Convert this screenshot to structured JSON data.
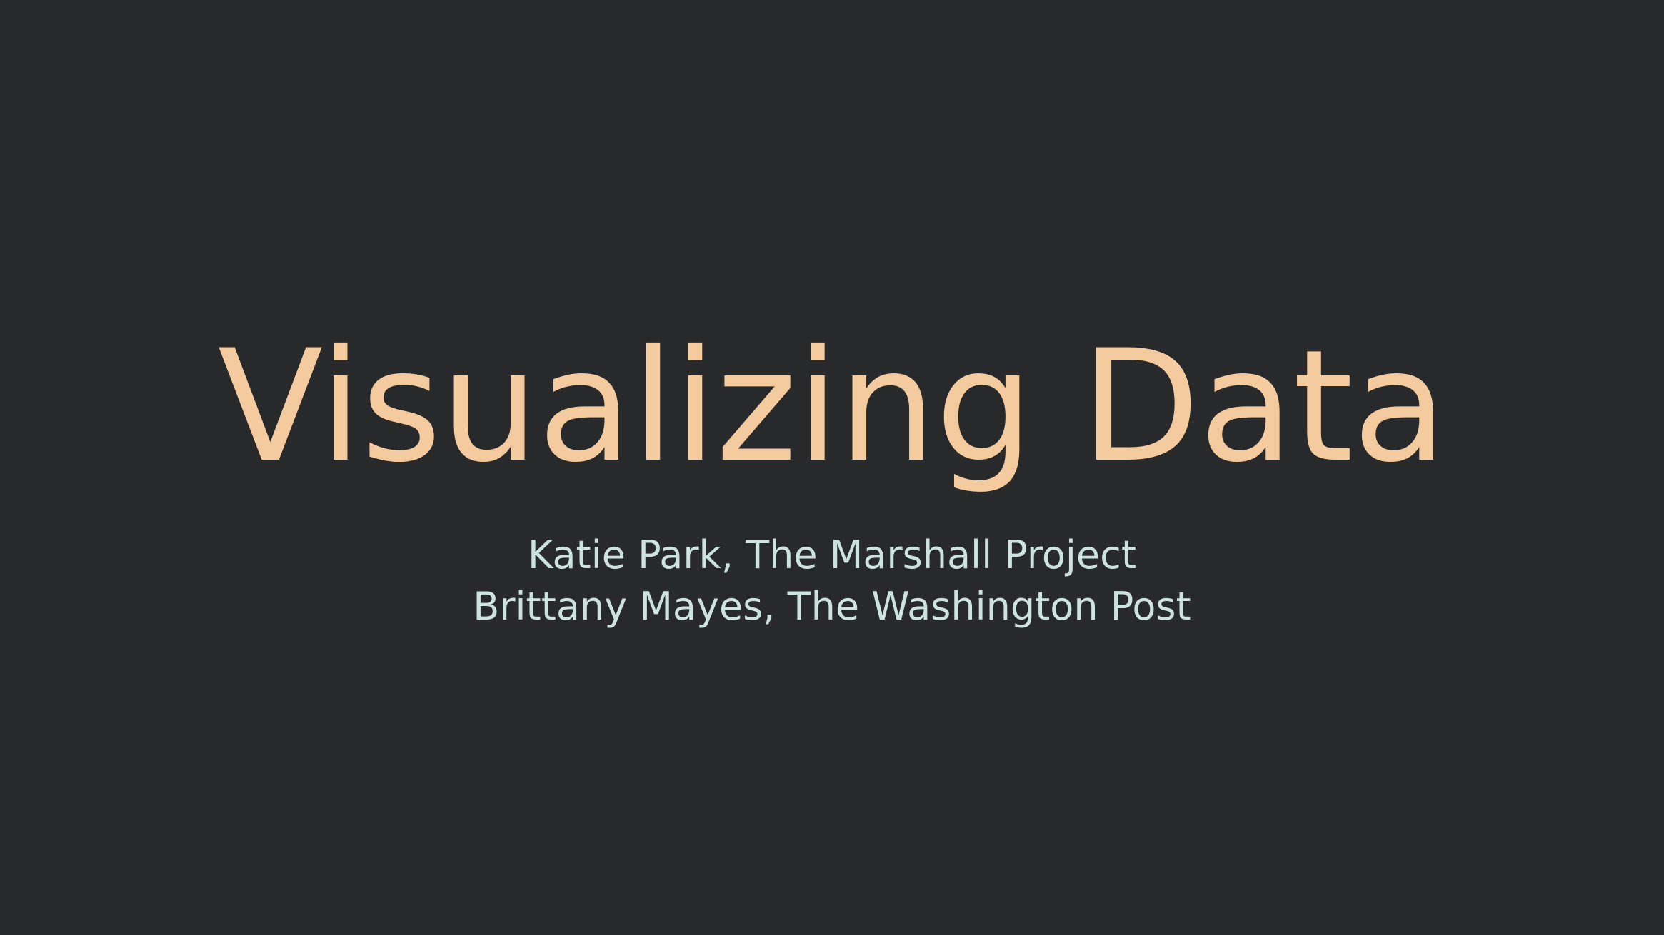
{
  "slide": {
    "title": "Visualizing Data",
    "authors": [
      "Katie Park, The Marshall Project",
      "Brittany Mayes, The Washington Post"
    ]
  },
  "colors": {
    "background": "#28292b",
    "title": "#f3cb9e",
    "authors": "#cde4de"
  }
}
